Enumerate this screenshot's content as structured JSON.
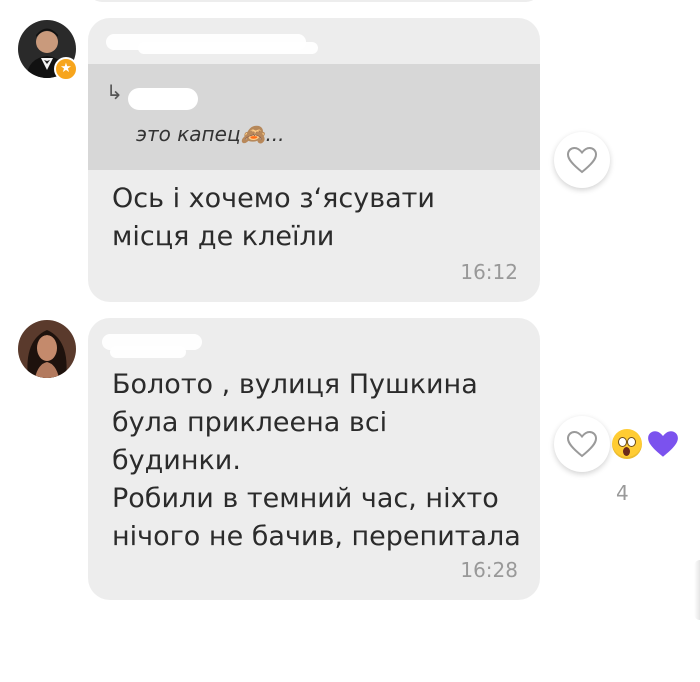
{
  "colors": {
    "bubble": "#ededed",
    "quote_background": "#d7d7d7",
    "badge": "#f7a51c",
    "heart_reaction": "#7b52ee",
    "time_text": "#999999"
  },
  "messages": [
    {
      "avatar_icon": "user-avatar-man-icon",
      "has_badge": true,
      "badge_icon": "star-icon",
      "reply": {
        "arrow": "↳",
        "text": "это капец🙈..."
      },
      "text": "Ось і хочемо з‘ясувати\nмісця де клеїли",
      "time": "16:12",
      "like_icon": "heart-outline-icon"
    },
    {
      "avatar_icon": "user-avatar-woman-icon",
      "text": "Болото , вулиця Пушкина\nбула приклеена всі\nбудинки.\nРобили в темний час, ніхто\nнічого не бачив, перепитала",
      "time": "16:28",
      "like_icon": "heart-outline-icon",
      "reactions": {
        "icons": [
          "wow-emoji-icon",
          "purple-heart-icon"
        ],
        "count": "4"
      }
    }
  ]
}
